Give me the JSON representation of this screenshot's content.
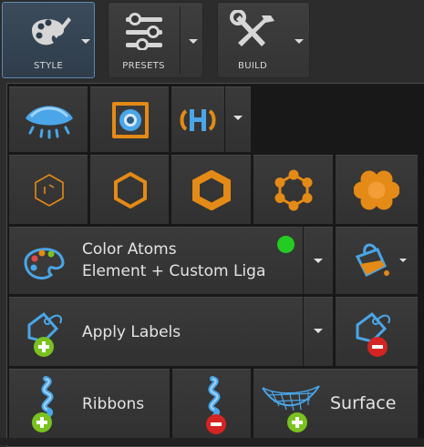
{
  "toolbar": {
    "style_label": "STYLE",
    "presets_label": "PRESETS",
    "build_label": "BUILD"
  },
  "row1": {
    "icons": [
      "eye-icon",
      "target-view-icon",
      "hydrogen-toggle-icon",
      "chevron-down-icon"
    ]
  },
  "row2": {
    "icons": [
      "stick-ring-icon",
      "thin-hexagon-icon",
      "thick-hexagon-icon",
      "ball-ring-icon",
      "sphere-cluster-icon"
    ]
  },
  "color_atoms": {
    "line1": "Color Atoms",
    "line2": "Element + Custom Liga",
    "status_color": "#22cc22",
    "icon": "palette-icon",
    "bucket_icon": "paint-bucket-icon"
  },
  "labels": {
    "apply_label": "Apply Labels",
    "add_icon": "add-label-icon",
    "remove_icon": "remove-label-icon"
  },
  "row5": {
    "ribbons_label": "Ribbons",
    "surface_label": "Surface",
    "add_ribbon_icon": "add-ribbon-icon",
    "remove_ribbon_icon": "remove-ribbon-icon",
    "surface_icon": "add-surface-icon"
  },
  "colors": {
    "accent_orange": "#e48a16",
    "add_green": "#7ac21f",
    "remove_red": "#d42424",
    "eye_blue": "#4aa6e8"
  }
}
